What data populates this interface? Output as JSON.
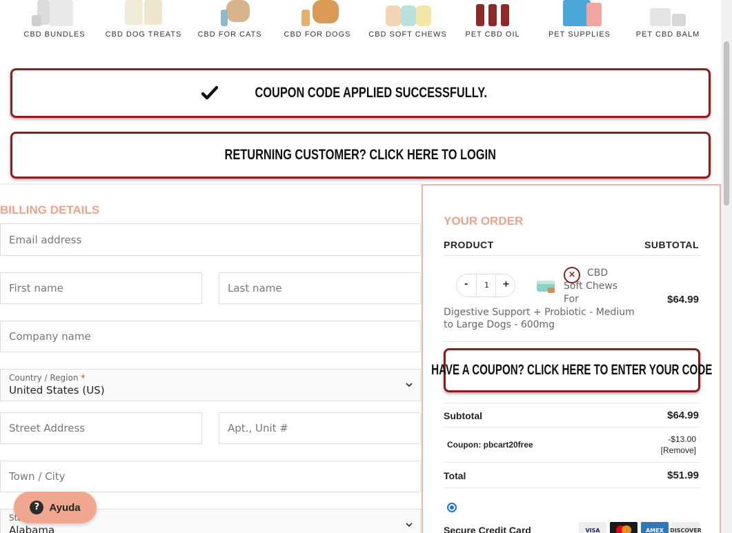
{
  "categories": [
    {
      "label": "CBD BUNDLES",
      "icon": "bundle-product-icon"
    },
    {
      "label": "CBD DOG TREATS",
      "icon": "dog-treats-product-icon"
    },
    {
      "label": "CBD FOR CATS",
      "icon": "cat-product-icon"
    },
    {
      "label": "CBD FOR DOGS",
      "icon": "dog-product-icon"
    },
    {
      "label": "CBD SOFT CHEWS",
      "icon": "soft-chews-product-icon"
    },
    {
      "label": "PET CBD OIL",
      "icon": "oil-bottles-product-icon"
    },
    {
      "label": "PET SUPPLIES",
      "icon": "supplies-product-icon"
    },
    {
      "label": "PET CBD BALM",
      "icon": "balm-product-icon"
    }
  ],
  "notices": {
    "coupon_applied": "Coupon code applied successfully.",
    "returning_customer": "Returning customer? Click here to login"
  },
  "billing": {
    "title": "Billing Details",
    "email_placeholder": "Email address",
    "first_name_placeholder": "First name",
    "last_name_placeholder": "Last name",
    "company_placeholder": "Company name",
    "country_label": "Country / Region",
    "country_required": "*",
    "country_value": "United States (US)",
    "street_placeholder": "Street Address",
    "apt_placeholder": "Apt., Unit #",
    "city_placeholder": "Town / City",
    "state_label": "State",
    "state_value": "Alabama"
  },
  "order": {
    "title": "Your Order",
    "col_product": "Product",
    "col_subtotal": "Subtotal",
    "item": {
      "quantity": "1",
      "minus": "-",
      "plus": "+",
      "remove": "×",
      "name_top": "CBD Soft Chews For",
      "name_bottom": "Digestive Support + Probiotic - Medium to Large Dogs - 600mg",
      "price": "$64.99"
    },
    "coupon_button": "Have a coupon? Click here to enter your code",
    "subtotal_label": "Subtotal",
    "subtotal_value": "$64.99",
    "coupon_label": "Coupon: pbcart20free",
    "coupon_value": "-$13.00",
    "coupon_remove": "[Remove]",
    "total_label": "Total",
    "total_value": "$51.99",
    "payment_label": "Secure Credit Card",
    "cards": [
      {
        "label": "VISA",
        "color": "#1a1f71",
        "bg": "#eeeeee"
      },
      {
        "label": "MC",
        "color": "#ffffff",
        "bg": "#1a1a1a"
      },
      {
        "label": "AMEX",
        "color": "#ffffff",
        "bg": "#2e77bb"
      },
      {
        "label": "DISCOVER",
        "color": "#333333",
        "bg": "#eeeeee"
      }
    ]
  },
  "help": {
    "label": "Ayuda"
  },
  "colors": {
    "accent_border": "#8b1d1d",
    "heading_salmon": "#e8a48f",
    "help_button": "#f1a78f"
  }
}
